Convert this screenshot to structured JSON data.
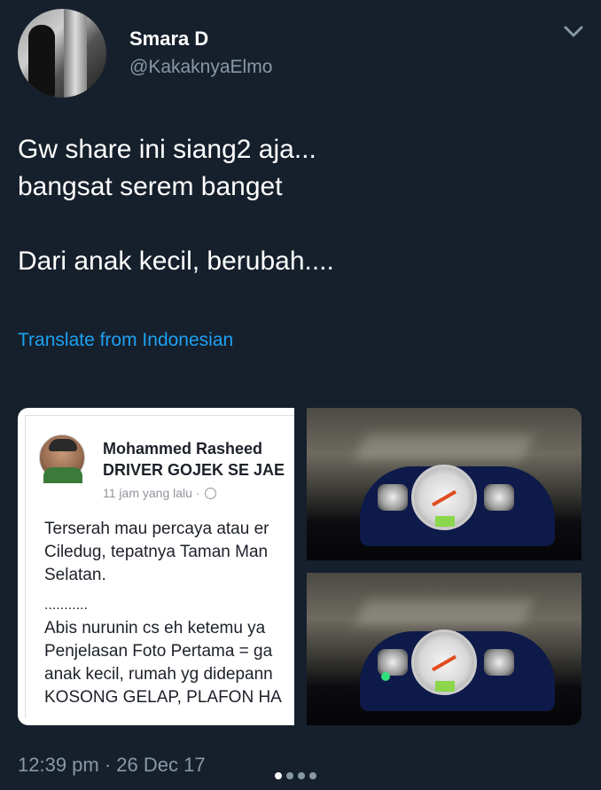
{
  "tweet": {
    "author": {
      "display_name": "Smara D",
      "handle": "@KakaknyaElmo"
    },
    "menu_icon": "chevron-down-icon",
    "text_paragraphs": [
      "Gw share ini siang2 aja...\nbangsat serem banget",
      "Dari anak kecil, berubah...."
    ],
    "translate_link": "Translate from Indonesian",
    "timestamp": "12:39 pm · 26 Dec 17"
  },
  "media": {
    "facebook_screenshot": {
      "name": "Mohammed Rasheed",
      "group": "DRIVER GOJEK SE JAE",
      "time": "11 jam yang lalu ·",
      "body_lines": "Terserah mau percaya atau er\nCiledug, tepatnya Taman Man\nSelatan.",
      "separator": "...........",
      "body_lines_2": "Abis nurunin cs eh ketemu ya\nPenjelasan Foto Pertama = ga\nanak kecil, rumah yg didepann\nKOSONG GELAP, PLAFON HA"
    },
    "photos": [
      "motorcycle-dashboard-night-photo",
      "motorcycle-dashboard-night-photo"
    ]
  },
  "pager": {
    "total": 4,
    "active": 1
  },
  "colors": {
    "background": "#16202c",
    "link": "#1da1f2",
    "muted": "#8899a6"
  }
}
